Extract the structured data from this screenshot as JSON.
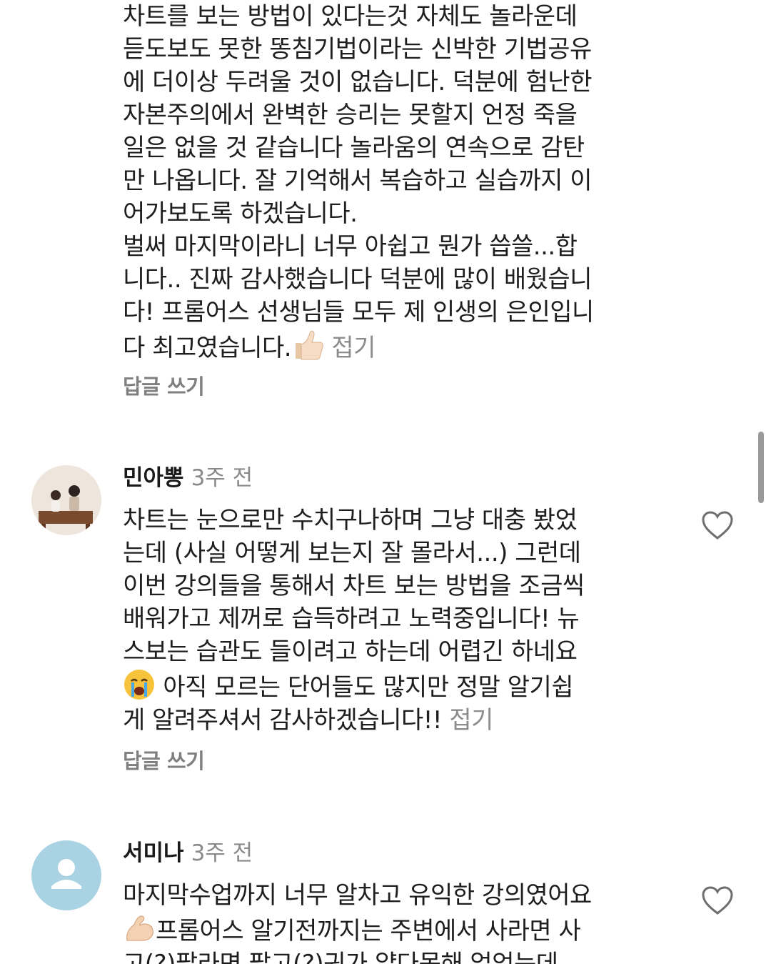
{
  "comments": [
    {
      "text_lines": [
        "차트를 보는 방법이 있다는것 자체도 놀라운데",
        "듣도보도 못한 똥침기법이라는 신박한 기법공유",
        "에 더이상 두려울 것이 없습니다. 덕분에 험난한",
        "자본주의에서 완벽한 승리는 못할지 언정 죽을",
        "일은 없을 것 같습니다 놀라움의 연속으로 감탄",
        "만 나옵니다. 잘 기억해서 복습하고 실습까지 이",
        "어가보도록 하겠습니다.",
        "벌써 마지막이라니 너무 아쉽고 뭔가 씁쓸...합",
        "니다.. 진짜 감사했습니다 덕분에 많이 배웠습니",
        "다! 프롬어스 선생님들 모두 제 인생의 은인입니"
      ],
      "last_line": "다 최고였습니다.",
      "emoji": "thumbs-up-icon",
      "collapse_label": "접기",
      "reply_label": "답글 쓰기"
    },
    {
      "author": "민아뽕",
      "time": "3주 전",
      "avatar": "photo-avatar",
      "text_lines": [
        "차트는 눈으로만 수치구나하며 그냥 대충 봤었",
        "는데 (사실 어떻게 보는지 잘 몰라서...) 그런데",
        "이번 강의들을 통해서 차트 보는 방법을 조금씩",
        "배워가고 제꺼로 습득하려고 노력중입니다! 뉴",
        "스보는 습관도 들이려고 하는데 어렵긴 하네요"
      ],
      "emoji_line": "아직 모르는 단어들도 많지만 정말 알기쉽",
      "emoji": "crying-face-icon",
      "last_line": "게 알려주셔서 감사하겠습니다!!",
      "collapse_label": "접기",
      "reply_label": "답글 쓰기"
    },
    {
      "author": "서미나",
      "time": "3주 전",
      "avatar": "default-user-avatar",
      "first_line": "마지막수업까지 너무 알차고 유익한 강의였어요",
      "emoji": "flexed-biceps-icon",
      "emoji_line": "프롬어스 알기전까지는 주변에서 사라면 사",
      "cut_line": "고(?)팔라면 팔고(?)귀가 얇다못해 없었는데"
    }
  ],
  "colors": {
    "text": "#1e1e1e",
    "muted": "#8c8c8c",
    "reply": "#7f7f7f",
    "avatar_default_bg": "#a9d3e3"
  }
}
